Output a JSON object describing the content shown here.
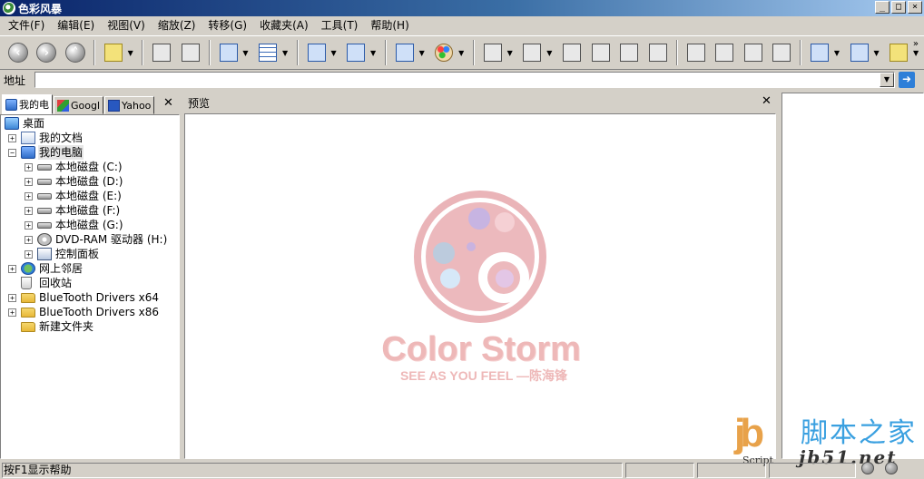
{
  "window": {
    "title": "色彩风暴"
  },
  "menu": [
    "文件(F)",
    "编辑(E)",
    "视图(V)",
    "缩放(Z)",
    "转移(G)",
    "收藏夹(A)",
    "工具(T)",
    "帮助(H)"
  ],
  "address": {
    "label": "地址",
    "value": ""
  },
  "tabs": [
    {
      "label": "我的电",
      "icon": "computer-icon"
    },
    {
      "label": "Googl",
      "icon": "google-icon"
    },
    {
      "label": "Yahoo",
      "icon": "yahoo-icon"
    }
  ],
  "tree": [
    {
      "label": "桌面",
      "icon": "desk",
      "depth": 0,
      "exp": ""
    },
    {
      "label": "我的文档",
      "icon": "docs",
      "depth": 1,
      "exp": "+"
    },
    {
      "label": "我的电脑",
      "icon": "pc",
      "depth": 1,
      "exp": "−",
      "selected": true
    },
    {
      "label": "本地磁盘 (C:)",
      "icon": "drive",
      "depth": 2,
      "exp": "+"
    },
    {
      "label": "本地磁盘 (D:)",
      "icon": "drive",
      "depth": 2,
      "exp": "+"
    },
    {
      "label": "本地磁盘 (E:)",
      "icon": "drive",
      "depth": 2,
      "exp": "+"
    },
    {
      "label": "本地磁盘 (F:)",
      "icon": "drive",
      "depth": 2,
      "exp": "+"
    },
    {
      "label": "本地磁盘 (G:)",
      "icon": "drive",
      "depth": 2,
      "exp": "+"
    },
    {
      "label": "DVD-RAM 驱动器 (H:)",
      "icon": "cd",
      "depth": 2,
      "exp": "+"
    },
    {
      "label": "控制面板",
      "icon": "cpl",
      "depth": 2,
      "exp": "+"
    },
    {
      "label": "网上邻居",
      "icon": "net",
      "depth": 1,
      "exp": "+"
    },
    {
      "label": "回收站",
      "icon": "bin",
      "depth": 1,
      "exp": ""
    },
    {
      "label": "BlueTooth Drivers x64",
      "icon": "folder",
      "depth": 1,
      "exp": "+"
    },
    {
      "label": "BlueTooth Drivers x86",
      "icon": "folder",
      "depth": 1,
      "exp": "+"
    },
    {
      "label": "新建文件夹",
      "icon": "folder",
      "depth": 1,
      "exp": ""
    }
  ],
  "preview": {
    "title": "预览",
    "brand": "Color Storm",
    "tagline": "SEE AS YOU FEEL —陈海锋"
  },
  "watermark": {
    "logo": "jb",
    "script": "Script",
    "site_cn": "脚本之家",
    "site_url": "jb51.net"
  },
  "status": {
    "text": "按F1显示帮助"
  },
  "colors": {
    "brand_pink": "#eeb8b8",
    "ring_pink": "#eab4b8",
    "watermark_blue": "#3aa0e0",
    "watermark_orange": "#e8a24a"
  }
}
